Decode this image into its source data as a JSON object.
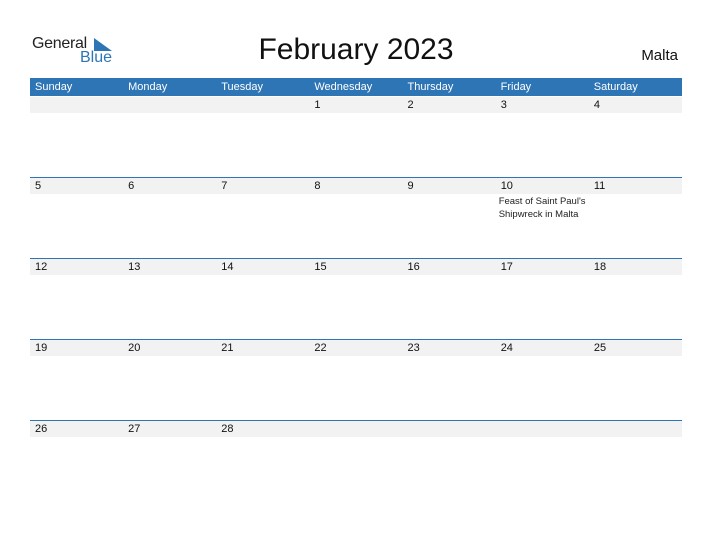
{
  "logo": {
    "word1": "General",
    "word2": "Blue"
  },
  "title": "February 2023",
  "country": "Malta",
  "colors": {
    "accent": "#2e75b6",
    "datebar": "#f2f2f2"
  },
  "weekdays": [
    "Sunday",
    "Monday",
    "Tuesday",
    "Wednesday",
    "Thursday",
    "Friday",
    "Saturday"
  ],
  "weeks": [
    [
      {
        "day": ""
      },
      {
        "day": ""
      },
      {
        "day": ""
      },
      {
        "day": "1"
      },
      {
        "day": "2"
      },
      {
        "day": "3"
      },
      {
        "day": "4"
      }
    ],
    [
      {
        "day": "5"
      },
      {
        "day": "6"
      },
      {
        "day": "7"
      },
      {
        "day": "8"
      },
      {
        "day": "9"
      },
      {
        "day": "10",
        "event": "Feast of Saint Paul's Shipwreck in Malta"
      },
      {
        "day": "11"
      }
    ],
    [
      {
        "day": "12"
      },
      {
        "day": "13"
      },
      {
        "day": "14"
      },
      {
        "day": "15"
      },
      {
        "day": "16"
      },
      {
        "day": "17"
      },
      {
        "day": "18"
      }
    ],
    [
      {
        "day": "19"
      },
      {
        "day": "20"
      },
      {
        "day": "21"
      },
      {
        "day": "22"
      },
      {
        "day": "23"
      },
      {
        "day": "24"
      },
      {
        "day": "25"
      }
    ],
    [
      {
        "day": "26"
      },
      {
        "day": "27"
      },
      {
        "day": "28"
      },
      {
        "day": ""
      },
      {
        "day": ""
      },
      {
        "day": ""
      },
      {
        "day": ""
      }
    ]
  ]
}
